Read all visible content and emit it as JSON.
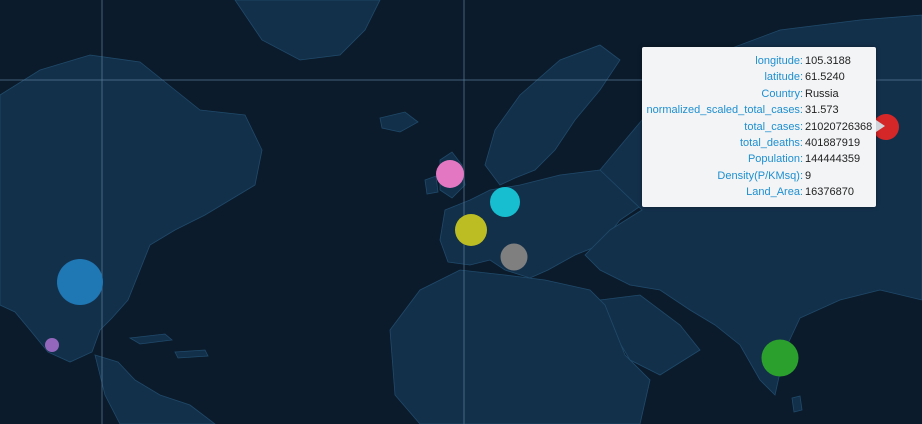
{
  "map": {
    "background_color": "#0b1b2b",
    "land_color": "#13304b",
    "border_color": "#1f4a6a"
  },
  "markers": [
    {
      "country": "United States",
      "color": "#1f77b4"
    },
    {
      "country": "Mexico",
      "color": "#9467bd"
    },
    {
      "country": "United Kingdom",
      "color": "#e377c2"
    },
    {
      "country": "Germany",
      "color": "#17becf"
    },
    {
      "country": "France",
      "color": "#bcbd22"
    },
    {
      "country": "Italy",
      "color": "#7f7f7f"
    },
    {
      "country": "India",
      "color": "#2ca02c"
    },
    {
      "country": "Russia",
      "color": "#d62728"
    }
  ],
  "tooltip": {
    "rows": [
      {
        "key": "longitude",
        "value": "105.3188"
      },
      {
        "key": "latitude",
        "value": "61.5240"
      },
      {
        "key": "Country",
        "value": "Russia"
      },
      {
        "key": "normalized_scaled_total_cases",
        "value": "31.573"
      },
      {
        "key": "total_cases",
        "value": "21020726368"
      },
      {
        "key": "total_deaths",
        "value": "401887919"
      },
      {
        "key": "Population",
        "value": "144444359"
      },
      {
        "key": "Density(P/KMsq)",
        "value": "9"
      },
      {
        "key": "Land_Area",
        "value": "16376870"
      }
    ]
  }
}
